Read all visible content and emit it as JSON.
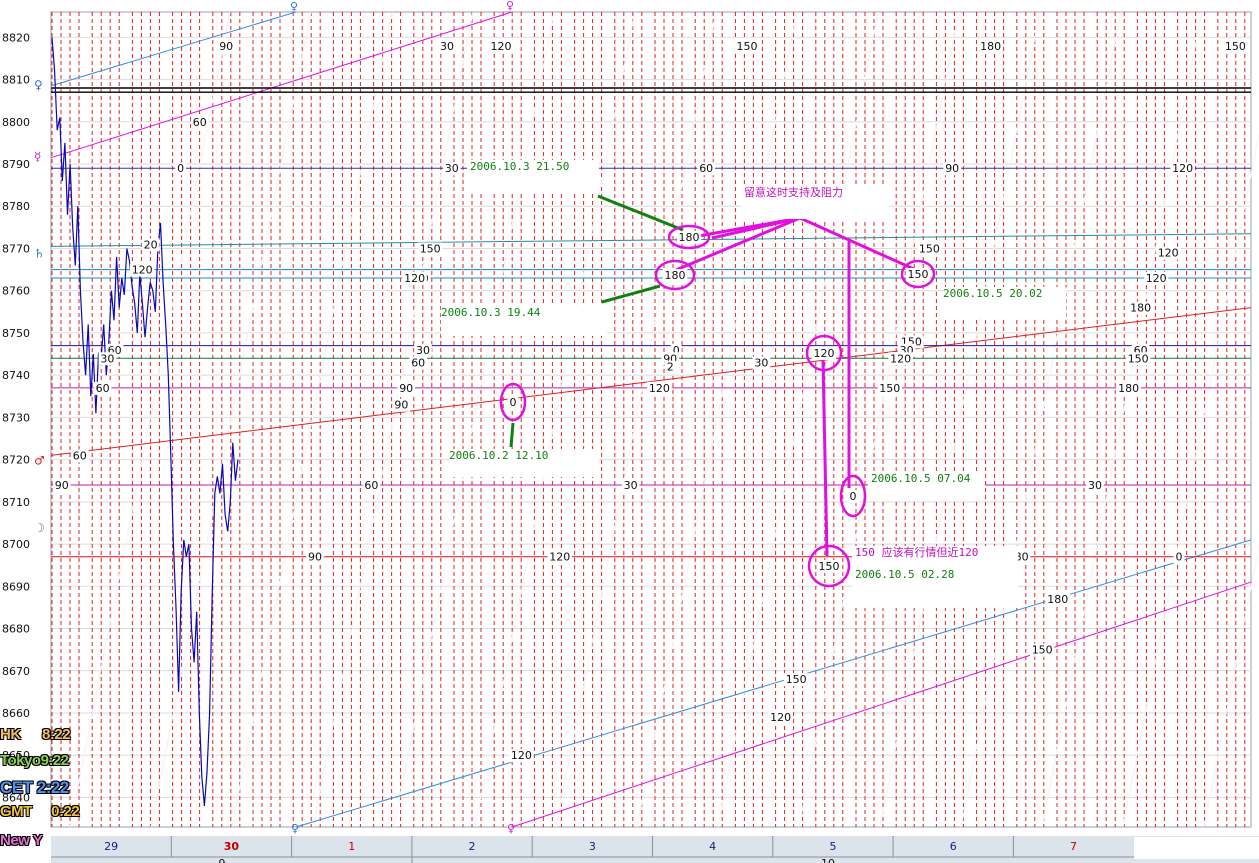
{
  "chart_data": {
    "type": "line",
    "title": "",
    "xlabel": "",
    "ylabel": "",
    "ylim": [
      1.8633,
      1.8826
    ],
    "y_ticks": [
      "1.8820",
      "1.8810",
      "1.8800",
      "1.8790",
      "1.8780",
      "1.8770",
      "1.8760",
      "1.8750",
      "1.8740",
      "1.8730",
      "1.8720",
      "1.8710",
      "1.8700",
      "1.8690",
      "1.8680",
      "1.8670",
      "1.8660",
      "1.8650",
      "1.8640"
    ],
    "x_axis": {
      "day_labels": [
        {
          "label": "29",
          "color": "#1a1a80"
        },
        {
          "label": "30",
          "color": "#c00000"
        },
        {
          "label": "1",
          "color": "#c00000"
        },
        {
          "label": "2",
          "color": "#1a1a80"
        },
        {
          "label": "3",
          "color": "#1a1a80"
        },
        {
          "label": "4",
          "color": "#1a1a80"
        },
        {
          "label": "5",
          "color": "#1a1a80"
        },
        {
          "label": "6",
          "color": "#1a1a80"
        },
        {
          "label": "7",
          "color": "#c00000"
        }
      ],
      "lower_labels": [
        "9",
        "10"
      ]
    },
    "price_series": {
      "name": "",
      "color": "#0a0ab4",
      "values": [
        1.882,
        1.8812,
        1.8798,
        1.8801,
        1.8786,
        1.8795,
        1.8778,
        1.879,
        1.8775,
        1.8766,
        1.878,
        1.876,
        1.8748,
        1.874,
        1.8752,
        1.8735,
        1.8745,
        1.8731,
        1.8745,
        1.8744,
        1.8752,
        1.874,
        1.8748,
        1.876,
        1.8753,
        1.8768,
        1.8756,
        1.8763,
        1.8759,
        1.877,
        1.8767,
        1.8761,
        1.8757,
        1.875,
        1.8764,
        1.8757,
        1.8749,
        1.8756,
        1.8762,
        1.876,
        1.8755,
        1.877,
        1.8776,
        1.8762,
        1.8752,
        1.874,
        1.8721,
        1.87,
        1.8685,
        1.8665,
        1.8689,
        1.8701,
        1.8697,
        1.87,
        1.868,
        1.8672,
        1.8684,
        1.866,
        1.8645,
        1.8638,
        1.8646,
        1.866,
        1.8688,
        1.8712,
        1.8716,
        1.8712,
        1.8719,
        1.8707,
        1.8703,
        1.871,
        1.8724,
        1.8715,
        1.872
      ]
    },
    "horizontal_lines": [
      {
        "price": 1.8808,
        "color": "#000000"
      },
      {
        "price": 1.8807,
        "color": "#000000"
      },
      {
        "price": 1.8789,
        "color": "#3030a0"
      },
      {
        "price": 1.8765,
        "color": "#1090c0"
      },
      {
        "price": 1.8763,
        "color": "#1090c0"
      },
      {
        "price": 1.8747,
        "color": "#1818a8"
      },
      {
        "price": 1.8744,
        "color": "#108040"
      },
      {
        "price": 1.8737,
        "color": "#b020b0"
      },
      {
        "price": 1.8714,
        "color": "#b020b0"
      },
      {
        "price": 1.8697,
        "color": "#e01010"
      }
    ],
    "price_ticks": [
      {
        "label": "60",
        "price": 1.8746,
        "pos": 0.053
      },
      {
        "label": "30",
        "price": 1.8744,
        "pos": 0.047
      },
      {
        "label": "60",
        "price": 1.8737,
        "pos": 0.043
      },
      {
        "label": "30",
        "price": 1.8746,
        "pos": 0.31
      },
      {
        "label": "60",
        "price": 1.8743,
        "pos": 0.306
      },
      {
        "label": "90",
        "price": 1.8737,
        "pos": 0.296
      },
      {
        "label": "90",
        "price": 1.8733,
        "pos": 0.292
      },
      {
        "label": "0",
        "price": 1.8746,
        "pos": 0.521
      },
      {
        "label": "90",
        "price": 1.8744,
        "pos": 0.516
      },
      {
        "label": "120",
        "price": 1.8737,
        "pos": 0.507
      },
      {
        "label": "30",
        "price": 1.8743,
        "pos": 0.592
      },
      {
        "label": "150",
        "price": 1.8748,
        "pos": 0.717
      },
      {
        "label": "30",
        "price": 1.8746,
        "pos": 0.713
      },
      {
        "label": "120",
        "price": 1.8744,
        "pos": 0.708
      },
      {
        "label": "150",
        "price": 1.8737,
        "pos": 0.699
      },
      {
        "label": "60",
        "price": 1.8746,
        "pos": 0.908
      },
      {
        "label": "150",
        "price": 1.8744,
        "pos": 0.906
      },
      {
        "label": "180",
        "price": 1.8737,
        "pos": 0.898
      },
      {
        "label": "60",
        "price": 1.8714,
        "pos": 0.267
      },
      {
        "label": "30",
        "price": 1.8714,
        "pos": 0.483
      },
      {
        "label": "30",
        "price": 1.8714,
        "pos": 0.87
      },
      {
        "label": "90",
        "price": 1.8714,
        "pos": 0.009
      },
      {
        "label": "90",
        "price": 1.8697,
        "pos": 0.22
      },
      {
        "label": "120",
        "price": 1.8697,
        "pos": 0.424
      },
      {
        "label": "180",
        "price": 1.8697,
        "pos": 0.806
      },
      {
        "label": "0",
        "price": 1.8697,
        "pos": 0.94
      },
      {
        "label": "120",
        "price": 1.8789,
        "pos": 0.943
      },
      {
        "label": "120",
        "price": 1.8769,
        "pos": 0.931
      },
      {
        "label": "120",
        "price": 1.8763,
        "pos": 0.921
      },
      {
        "label": "90",
        "price": 1.8789,
        "pos": 0.751
      },
      {
        "label": "60",
        "price": 1.8789,
        "pos": 0.546
      },
      {
        "label": "30",
        "price": 1.8789,
        "pos": 0.334
      },
      {
        "label": "0",
        "price": 1.8789,
        "pos": 0.108
      },
      {
        "label": "60",
        "price": 1.88,
        "pos": 0.124
      },
      {
        "label": "90",
        "price": 1.8818,
        "pos": 0.146
      },
      {
        "label": "30",
        "price": 1.8818,
        "pos": 0.33
      },
      {
        "label": "120",
        "price": 1.8818,
        "pos": 0.375
      },
      {
        "label": "150",
        "price": 1.8818,
        "pos": 0.58
      },
      {
        "label": "180",
        "price": 1.8818,
        "pos": 0.783
      },
      {
        "label": "150",
        "price": 1.8818,
        "pos": 0.987
      },
      {
        "label": "150",
        "price": 1.877,
        "pos": 0.316
      },
      {
        "label": "150",
        "price": 1.8763,
        "pos": 0.306
      },
      {
        "label": "120",
        "price": 1.8763,
        "pos": 0.303
      },
      {
        "label": "150",
        "price": 1.877,
        "pos": 0.732
      },
      {
        "label": "180",
        "price": 1.8756,
        "pos": 0.908
      },
      {
        "label": "20",
        "price": 1.8771,
        "pos": 0.083
      },
      {
        "label": "120",
        "price": 1.8765,
        "pos": 0.076
      },
      {
        "label": "60",
        "price": 1.8721,
        "pos": 0.024
      },
      {
        "label": "180",
        "price": 1.8687,
        "pos": 0.839
      },
      {
        "label": "150",
        "price": 1.8675,
        "pos": 0.826
      },
      {
        "label": "150",
        "price": 1.8668,
        "pos": 0.621
      },
      {
        "label": "120",
        "price": 1.8659,
        "pos": 0.608
      },
      {
        "label": "120",
        "price": 1.865,
        "pos": 0.392
      },
      {
        "label": "2",
        "price": 1.8742,
        "pos": 0.516
      }
    ],
    "annotations": [
      {
        "text": "2006.10.3   21.50",
        "color": "#108010"
      },
      {
        "text": "2006.10.3     19.44",
        "color": "#108010"
      },
      {
        "text": "2006.10.2    12.10",
        "color": "#108010"
      },
      {
        "text": "2006.10.5   20.02",
        "color": "#108010"
      },
      {
        "text": "2006.10.5   07.04",
        "color": "#108010"
      },
      {
        "text": "2006.10.5   02.28",
        "color": "#108010"
      },
      {
        "text": "留意这时支持及阻力",
        "color": "#c010c0"
      },
      {
        "text": "150  应该有行情但近120",
        "color": "#c010c0"
      }
    ],
    "circled_marks": [
      "180",
      "180",
      "150",
      "0",
      "120",
      "0",
      "150"
    ],
    "angle_labels": [
      "0",
      "30",
      "60",
      "90",
      "120",
      "150",
      "180"
    ]
  },
  "clocks": [
    {
      "city": "HK",
      "time": "8:22",
      "color": "#f0c060"
    },
    {
      "city": "Tokyo",
      "time": "9:22",
      "color": "#90d050"
    },
    {
      "city": "CET",
      "time": "2:22",
      "color": "#5090f0"
    },
    {
      "city": "GMT",
      "time": "0:22",
      "color": "#f0c040"
    },
    {
      "city": "New Y",
      "time": "",
      "color": "#e070d0"
    }
  ],
  "colors": {
    "grid_red": "#e02020",
    "price": "#0a0ab4",
    "magenta": "#e010e0",
    "green": "#108010"
  }
}
